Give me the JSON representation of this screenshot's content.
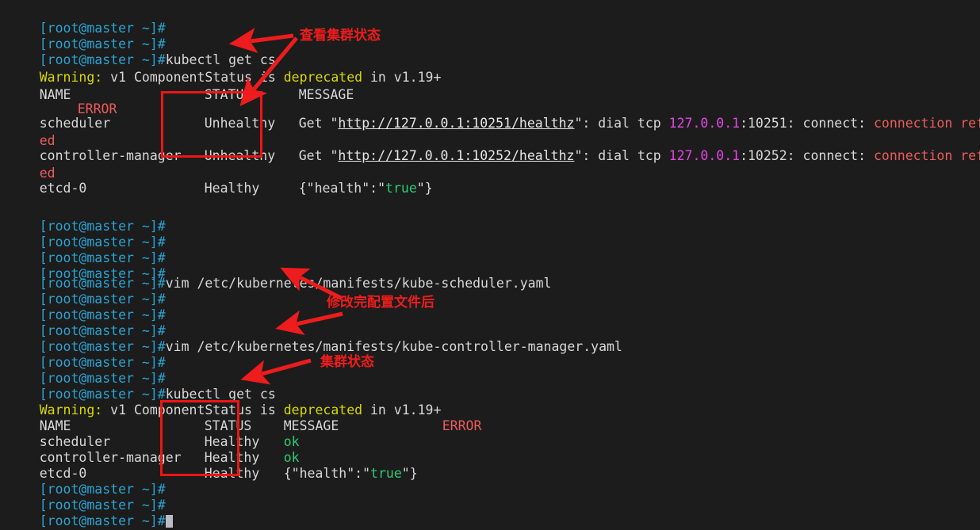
{
  "window": {
    "title": "root@master terminal",
    "background_color": "#1c1c1c",
    "foreground_color": "#d6d6d6"
  },
  "colors": {
    "prompt": "#29a4d4",
    "warning": "#d7d700",
    "error": "#e8453c",
    "success": "#2ecc71",
    "ip": "#e346e3",
    "annotation": "#ee1c1c",
    "box": "#f01414"
  },
  "prompt": {
    "text": "[root@master ~]#"
  },
  "commands": {
    "get_cs": "kubectl get cs",
    "vim_scheduler": "vim /etc/kubernetes/manifests/kube-scheduler.yaml",
    "vim_controller": "vim /etc/kubernetes/manifests/kube-controller-manager.yaml"
  },
  "warning_line": {
    "prefix": "Warning:",
    "body": " v1 ComponentStatus is ",
    "keyword": "deprecated",
    "suffix": " in v1.19+"
  },
  "first_table": {
    "headers": {
      "name": "NAME",
      "status": "STATUS",
      "message": "MESSAGE",
      "error": "ERROR"
    },
    "rows": [
      {
        "name": "scheduler",
        "status": "Unhealthy",
        "message_prefix": "Get \"",
        "message_url": "http://127.0.0.1:10251/healthz",
        "message_mid": "\": dial tcp ",
        "message_ip": "127.0.0.1",
        "message_port": ":10251: connect: ",
        "message_error": "connection refus",
        "message_error_wrap": "ed"
      },
      {
        "name": "controller-manager",
        "status": "Unhealthy",
        "message_prefix": "Get \"",
        "message_url": "http://127.0.0.1:10252/healthz",
        "message_mid": "\": dial tcp ",
        "message_ip": "127.0.0.1",
        "message_port": ":10252: connect: ",
        "message_error": "connection refus",
        "message_error_wrap": "ed"
      },
      {
        "name": "etcd-0",
        "status": "Healthy",
        "message_json_open": "{\"health\":\"",
        "message_json_value": "true",
        "message_json_close": "\"}"
      }
    ]
  },
  "second_table": {
    "headers": {
      "name": "NAME",
      "status": "STATUS",
      "message": "MESSAGE",
      "error": "ERROR"
    },
    "rows": [
      {
        "name": "scheduler",
        "status": "Healthy",
        "message": "ok"
      },
      {
        "name": "controller-manager",
        "status": "Healthy",
        "message": "ok"
      },
      {
        "name": "etcd-0",
        "status": "Healthy",
        "message_json_open": "{\"health\":\"",
        "message_json_value": "true",
        "message_json_close": "\"}"
      }
    ]
  },
  "annotations": [
    {
      "id": "check-cluster-status",
      "text": "查看集群状态"
    },
    {
      "id": "after-editing-config",
      "text": "修改完配置文件后"
    },
    {
      "id": "cluster-status",
      "text": "集群状态"
    }
  ]
}
